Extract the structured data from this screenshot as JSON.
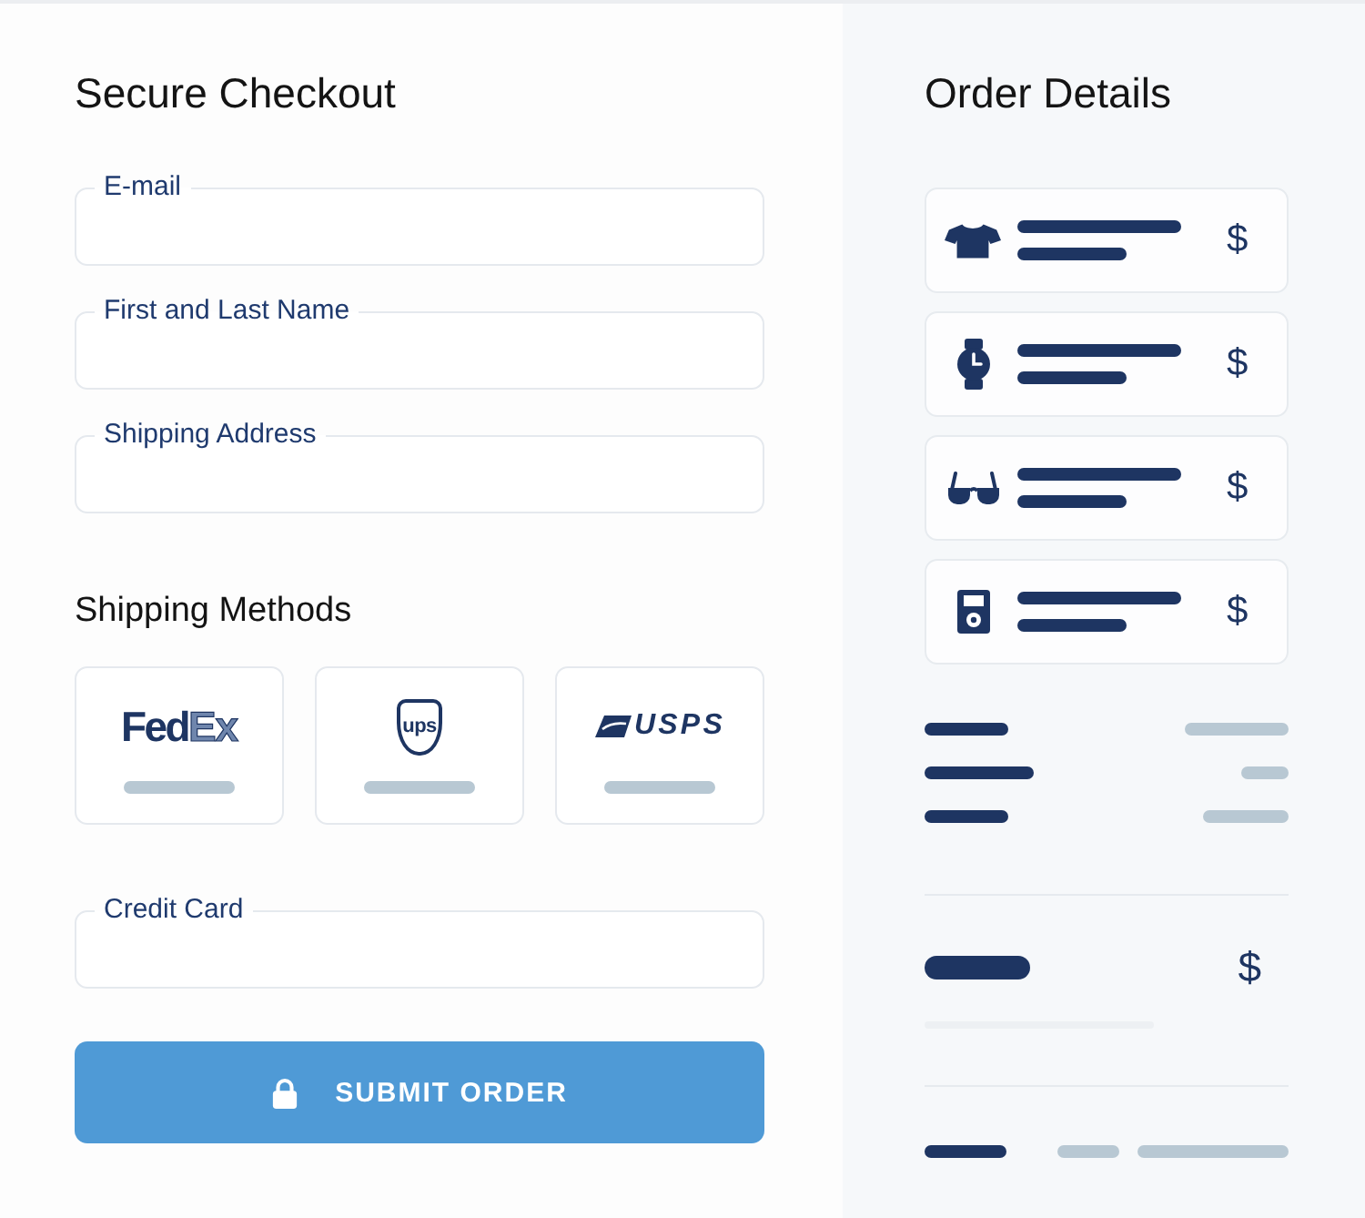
{
  "checkout": {
    "title": "Secure Checkout",
    "fields": [
      {
        "label": "E-mail"
      },
      {
        "label": "First and Last Name"
      },
      {
        "label": "Shipping Address"
      }
    ]
  },
  "shipping": {
    "title": "Shipping Methods",
    "methods": [
      {
        "kind": "wordmark",
        "selected": false,
        "logo": [
          {
            "text": "Fed",
            "outlined": false
          },
          {
            "text": "Ex",
            "outlined": true
          }
        ]
      },
      {
        "kind": "shield",
        "selected": false,
        "logo": [
          {
            "text": "ups",
            "outlined": false
          }
        ]
      },
      {
        "kind": "emblem",
        "selected": false,
        "logo": [
          {
            "text": "USPS",
            "outlined": false
          }
        ]
      }
    ]
  },
  "payment": {
    "fields": [
      {
        "label": "Credit Card"
      }
    ]
  },
  "submit_button": {
    "label": "SUBMIT ORDER"
  },
  "order_details": {
    "title": "Order Details",
    "items": [
      {
        "kind": "shirt",
        "price": "$"
      },
      {
        "kind": "watch",
        "price": "$"
      },
      {
        "kind": "glasses",
        "price": "$"
      },
      {
        "kind": "music_player",
        "price": "$"
      }
    ],
    "total": {
      "price": "$"
    }
  }
}
